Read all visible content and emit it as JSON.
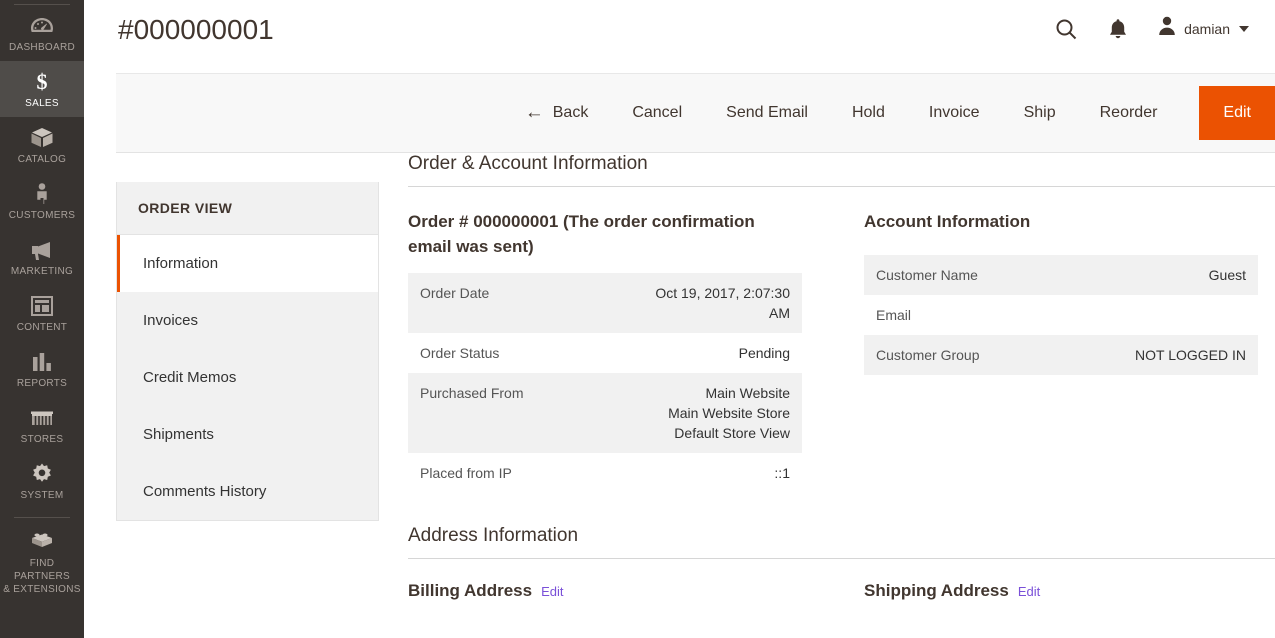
{
  "sidebar": {
    "items": [
      {
        "label": "Dashboard",
        "icon": "dashboard-gauge-icon",
        "active": false
      },
      {
        "label": "Sales",
        "icon": "dollar-sign-icon",
        "active": true
      },
      {
        "label": "Catalog",
        "icon": "box-icon",
        "active": false
      },
      {
        "label": "Customers",
        "icon": "person-icon",
        "active": false
      },
      {
        "label": "Marketing",
        "icon": "megaphone-icon",
        "active": false
      },
      {
        "label": "Content",
        "icon": "layout-panel-icon",
        "active": false
      },
      {
        "label": "Reports",
        "icon": "bar-chart-icon",
        "active": false
      },
      {
        "label": "Stores",
        "icon": "storefront-icon",
        "active": false
      },
      {
        "label": "System",
        "icon": "gear-icon",
        "active": false
      },
      {
        "label": "Find Partners\n& Extensions",
        "icon": "lego-brick-icon",
        "active": false
      }
    ]
  },
  "header": {
    "title": "#000000001",
    "search_icon": "search-icon",
    "notifications_icon": "bell-icon",
    "user": "damian",
    "avatar_icon": "user-avatar-icon",
    "caret_icon": "chevron-down-icon"
  },
  "toolbar": {
    "back": "Back",
    "back_arrow": "←",
    "cancel": "Cancel",
    "send_email": "Send Email",
    "hold": "Hold",
    "invoice": "Invoice",
    "ship": "Ship",
    "reorder": "Reorder",
    "edit": "Edit",
    "edit_color": "#eb5202"
  },
  "order_view": {
    "title": "Order View",
    "items": [
      {
        "label": "Information",
        "active": true
      },
      {
        "label": "Invoices",
        "active": false
      },
      {
        "label": "Credit Memos",
        "active": false
      },
      {
        "label": "Shipments",
        "active": false
      },
      {
        "label": "Comments History",
        "active": false
      }
    ]
  },
  "order_account": {
    "section_title": "Order & Account Information",
    "order_block_title": "Order # 000000001 (The order confirmation email was sent)",
    "order_rows": [
      {
        "label": "Order Date",
        "value": "Oct 19, 2017, 2:07:30 AM"
      },
      {
        "label": "Order Status",
        "value": "Pending"
      },
      {
        "label": "Purchased From",
        "value": "Main Website\nMain Website Store\nDefault Store View"
      },
      {
        "label": "Placed from IP",
        "value": "::1"
      }
    ],
    "account_block_title": "Account Information",
    "account_rows": [
      {
        "label": "Customer Name",
        "value": "Guest"
      },
      {
        "label": "Email",
        "value": ""
      },
      {
        "label": "Customer Group",
        "value": "NOT LOGGED IN"
      }
    ]
  },
  "address": {
    "section_title": "Address Information",
    "billing_title": "Billing Address",
    "billing_edit": "Edit",
    "shipping_title": "Shipping Address",
    "shipping_edit": "Edit"
  }
}
